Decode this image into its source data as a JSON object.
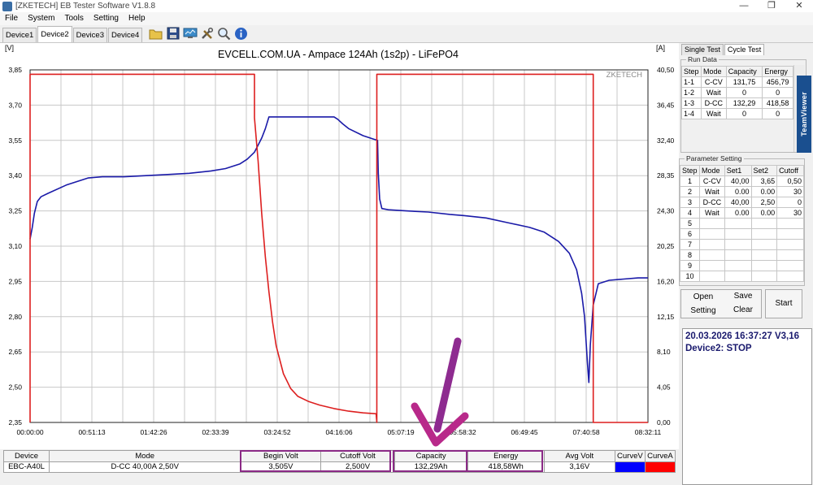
{
  "window": {
    "title": "[ZKETECH] EB Tester Software V1.8.8",
    "controls": {
      "minimize": "—",
      "maximize": "❐",
      "close": "✕"
    }
  },
  "menu": [
    "File",
    "System",
    "Tools",
    "Setting",
    "Help"
  ],
  "device_tabs": [
    {
      "label": "Device1",
      "active": false
    },
    {
      "label": "Device2",
      "active": true
    },
    {
      "label": "Device3",
      "active": false
    },
    {
      "label": "Device4",
      "active": false
    }
  ],
  "toolbar_icons": [
    "folder-icon",
    "save-icon",
    "monitor-icon",
    "tools-icon",
    "search-icon",
    "info-icon"
  ],
  "chart_data": {
    "type": "line",
    "title": "EVCELL.COM.UA - Ampace 124Ah (1s2p) - LiFePO4",
    "watermark": "ZKETECH",
    "ylabel_left": "[V]",
    "ylabel_right": "[A]",
    "ylim_left": [
      2.35,
      3.85
    ],
    "ylim_right": [
      0,
      40.5
    ],
    "yticks_left": [
      "3,85",
      "3,70",
      "3,55",
      "3,40",
      "3,25",
      "3,10",
      "2,95",
      "2,80",
      "2,65",
      "2,50",
      "2,35"
    ],
    "yticks_right": [
      "40,50",
      "36,45",
      "32,40",
      "28,35",
      "24,30",
      "20,25",
      "16,20",
      "12,15",
      "8,10",
      "4,05",
      "0,00"
    ],
    "xticks": [
      "00:00:00",
      "00:51:13",
      "01:42:26",
      "02:33:39",
      "03:24:52",
      "04:16:06",
      "05:07:19",
      "05:58:32",
      "06:49:45",
      "07:40:58",
      "08:32:11"
    ],
    "xlim_hours": [
      0,
      8.536
    ],
    "grid": true,
    "series": [
      {
        "name": "CurveV",
        "color": "#1a1aa8",
        "axis": "left",
        "x": [
          0,
          0.03,
          0.06,
          0.1,
          0.15,
          0.25,
          0.5,
          0.8,
          1.0,
          1.3,
          1.6,
          1.9,
          2.2,
          2.5,
          2.7,
          2.9,
          3.0,
          3.1,
          3.15,
          3.2,
          3.25,
          3.3,
          3.5,
          4.0,
          4.2,
          4.25,
          4.32,
          4.4,
          4.6,
          4.75,
          4.8,
          4.81,
          4.83,
          4.86,
          4.95,
          5.2,
          5.5,
          5.8,
          6.0,
          6.3,
          6.6,
          6.9,
          7.1,
          7.3,
          7.45,
          7.55,
          7.62,
          7.66,
          7.68,
          7.7,
          7.72,
          7.74,
          7.78,
          7.85,
          8.0,
          8.2,
          8.4,
          8.536
        ],
        "y": [
          3.13,
          3.18,
          3.24,
          3.29,
          3.31,
          3.325,
          3.36,
          3.39,
          3.395,
          3.395,
          3.4,
          3.405,
          3.41,
          3.42,
          3.43,
          3.45,
          3.47,
          3.5,
          3.53,
          3.56,
          3.6,
          3.65,
          3.65,
          3.65,
          3.65,
          3.64,
          3.62,
          3.6,
          3.57,
          3.555,
          3.55,
          3.41,
          3.3,
          3.26,
          3.255,
          3.25,
          3.245,
          3.235,
          3.23,
          3.22,
          3.2,
          3.18,
          3.16,
          3.12,
          3.07,
          3.0,
          2.9,
          2.8,
          2.7,
          2.6,
          2.52,
          2.68,
          2.85,
          2.94,
          2.955,
          2.96,
          2.965,
          2.965
        ]
      },
      {
        "name": "CurveA",
        "color": "#dd1f1f",
        "axis": "right",
        "x": [
          0,
          0.0,
          0.02,
          3.1,
          3.1,
          3.15,
          3.2,
          3.25,
          3.3,
          3.35,
          3.4,
          3.5,
          3.6,
          3.7,
          3.85,
          4.0,
          4.2,
          4.4,
          4.6,
          4.78,
          4.79,
          4.79,
          7.78,
          7.78,
          8.536
        ],
        "y": [
          0,
          40.0,
          40.0,
          40.0,
          35.0,
          30.0,
          24.0,
          19.0,
          15.0,
          11.5,
          8.8,
          5.6,
          3.9,
          3.0,
          2.4,
          2.0,
          1.6,
          1.3,
          1.1,
          1.0,
          0,
          40.0,
          40.0,
          0,
          0
        ]
      }
    ]
  },
  "summary": {
    "headers": [
      "Device",
      "Mode",
      "Begin Volt",
      "Cutoff Volt",
      "Capacity",
      "Energy",
      "Avg Volt",
      "CurveV",
      "CurveA"
    ],
    "values": [
      "EBC-A40L",
      "D-CC  40,00A  2,50V",
      "3,505V",
      "2,500V",
      "132,29Ah",
      "418,58Wh",
      "3,16V",
      "",
      ""
    ],
    "curve_colors": {
      "CurveV": "#0000ff",
      "CurveA": "#ff0000"
    }
  },
  "right_panel": {
    "tabs": [
      {
        "label": "Single Test",
        "active": false
      },
      {
        "label": "Cycle Test",
        "active": true
      }
    ],
    "run_data": {
      "title": "Run Data",
      "headers": [
        "Step",
        "Mode",
        "Capacity",
        "Energy"
      ],
      "rows": [
        [
          "1-1",
          "C-CV",
          "131,75",
          "456,79"
        ],
        [
          "1-2",
          "Wait",
          "0",
          "0"
        ],
        [
          "1-3",
          "D-CC",
          "132,29",
          "418,58"
        ],
        [
          "1-4",
          "Wait",
          "0",
          "0"
        ]
      ]
    },
    "parameter_setting": {
      "title": "Parameter Setting",
      "headers": [
        "Step",
        "Mode",
        "Set1",
        "Set2",
        "Cutoff"
      ],
      "rows": [
        [
          "1",
          "C-CV",
          "40,00",
          "3,65",
          "0,50"
        ],
        [
          "2",
          "Wait",
          "0.00",
          "0.00",
          "30"
        ],
        [
          "3",
          "D-CC",
          "40,00",
          "2,50",
          "0"
        ],
        [
          "4",
          "Wait",
          "0.00",
          "0.00",
          "30"
        ],
        [
          "5",
          "",
          "",
          "",
          ""
        ],
        [
          "6",
          "",
          "",
          "",
          ""
        ],
        [
          "7",
          "",
          "",
          "",
          ""
        ],
        [
          "8",
          "",
          "",
          "",
          ""
        ],
        [
          "9",
          "",
          "",
          "",
          ""
        ],
        [
          "10",
          "",
          "",
          "",
          ""
        ]
      ]
    },
    "buttons": {
      "open": "Open",
      "save": "Save",
      "setting": "Setting",
      "clear": "Clear",
      "start": "Start"
    },
    "status": {
      "datetime": "20.03.2026 16:37:27  V3,16",
      "device_state": "Device2: STOP"
    },
    "teamviewer_label": "TeamViewer"
  }
}
